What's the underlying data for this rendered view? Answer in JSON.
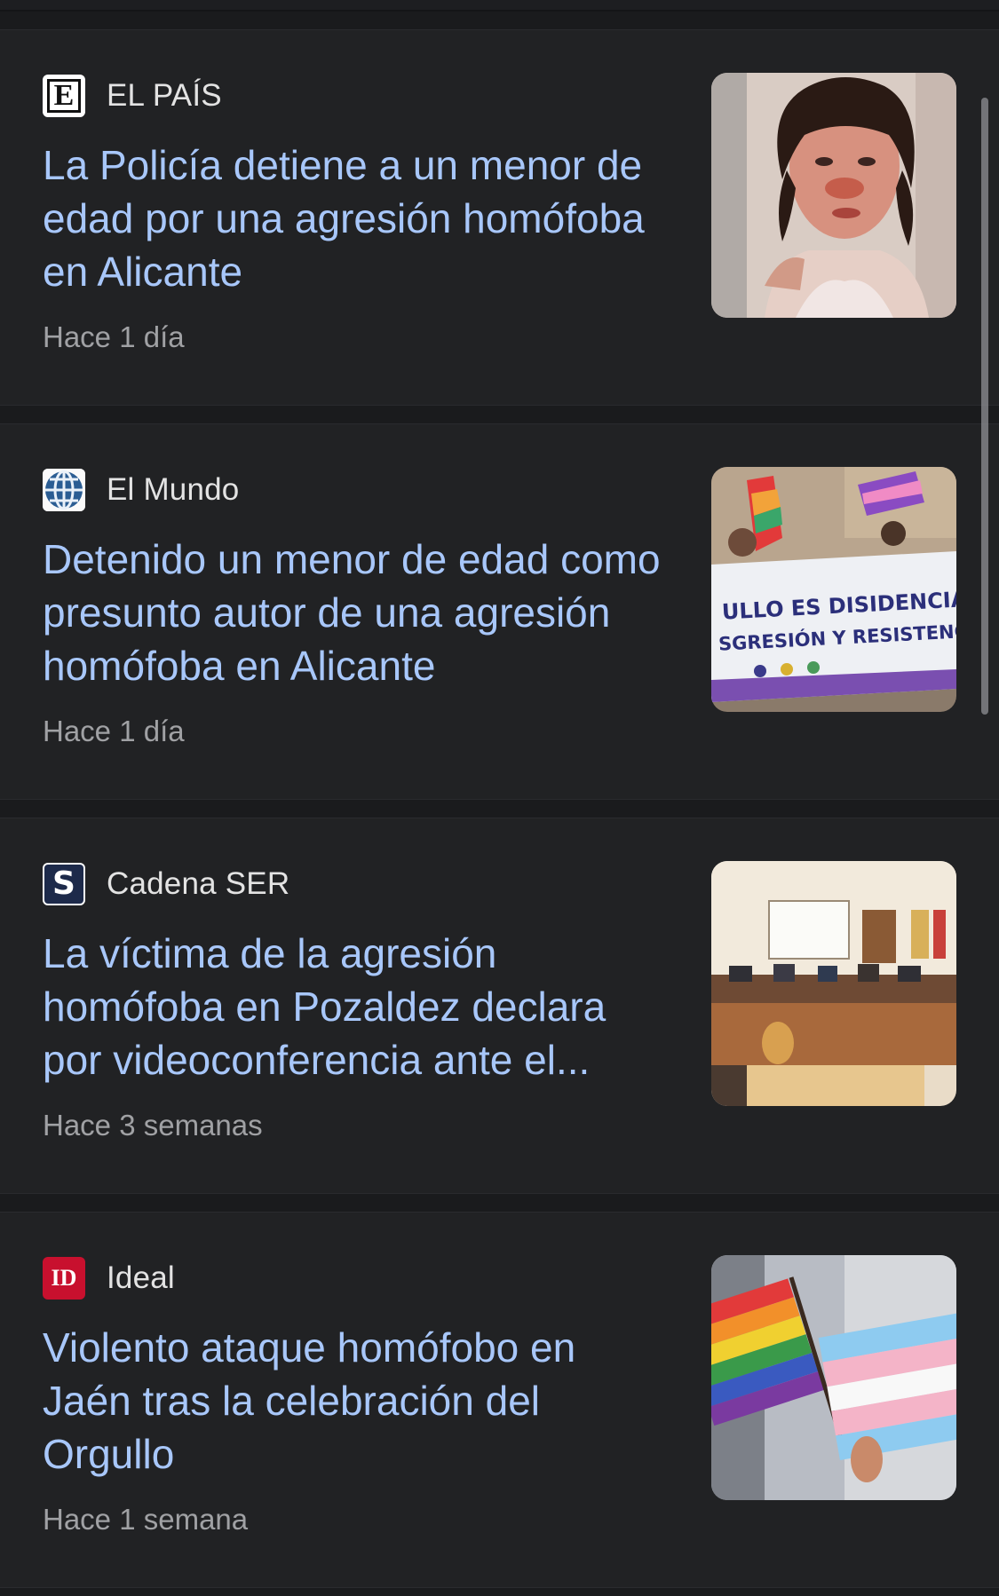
{
  "articles": [
    {
      "source": "EL PAÍS",
      "logo_icon": "el-pais-logo-icon",
      "logo_text": "E",
      "headline": "La Policía detiene a un menor de edad por una agresión homófoba en Alicante",
      "time": "Hace 1 día",
      "thumbnail": "portrait-injured-person-image"
    },
    {
      "source": "El Mundo",
      "logo_icon": "el-mundo-logo-icon",
      "logo_text": "",
      "headline": "Detenido un menor de edad como presunto autor de una agresión homófoba en Alicante",
      "time": "Hace 1 día",
      "thumbnail": "pride-protest-banner-image",
      "thumbnail_banner_lines": [
        "ULLO ES DISIDENCIA,",
        "SGRESIÓN Y RESISTENCIA"
      ]
    },
    {
      "source": "Cadena SER",
      "logo_icon": "cadena-ser-logo-icon",
      "logo_text": "S",
      "headline": "La víctima de la agresión homófoba en Pozaldez declara por videoconferencia ante el...",
      "time": "Hace 3 semanas",
      "thumbnail": "courtroom-image"
    },
    {
      "source": "Ideal",
      "logo_icon": "ideal-logo-icon",
      "logo_text": "ID",
      "headline": "Violento ataque homófobo en Jaén tras la celebración del Orgullo",
      "time": "Hace 1 semana",
      "thumbnail": "pride-and-trans-flags-image"
    }
  ],
  "colors": {
    "background": "#1a1b1d",
    "card": "#212224",
    "headline": "#a8c7fa",
    "source": "#e3e3e3",
    "time": "#a0a1a4"
  }
}
